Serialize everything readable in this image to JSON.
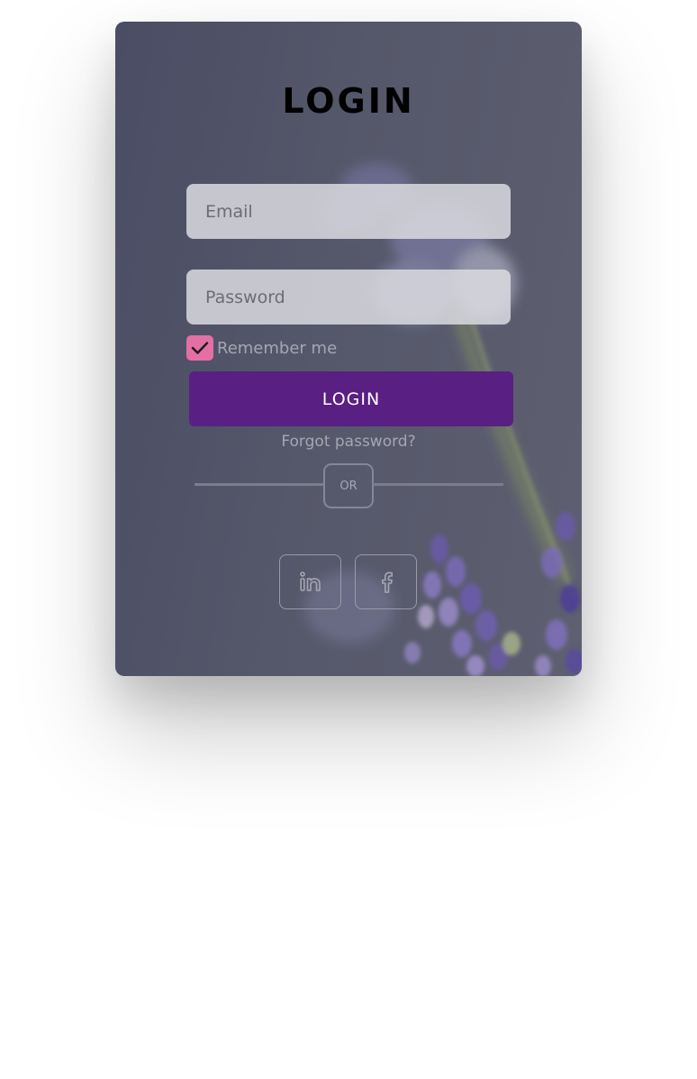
{
  "form": {
    "title": "LOGIN",
    "email_placeholder": "Email",
    "password_placeholder": "Password",
    "remember_label": "Remember me",
    "remember_checked": true,
    "login_button": "LOGIN",
    "forgot_link": "Forgot password?",
    "divider_text": "OR"
  },
  "social": [
    {
      "icon": "linkedin-icon"
    },
    {
      "icon": "facebook-icon"
    }
  ],
  "colors": {
    "login_button": "#5a1f82",
    "checkbox": "#e36fa5",
    "card_overlay": "#55576a",
    "field_background": "#dadae0"
  }
}
